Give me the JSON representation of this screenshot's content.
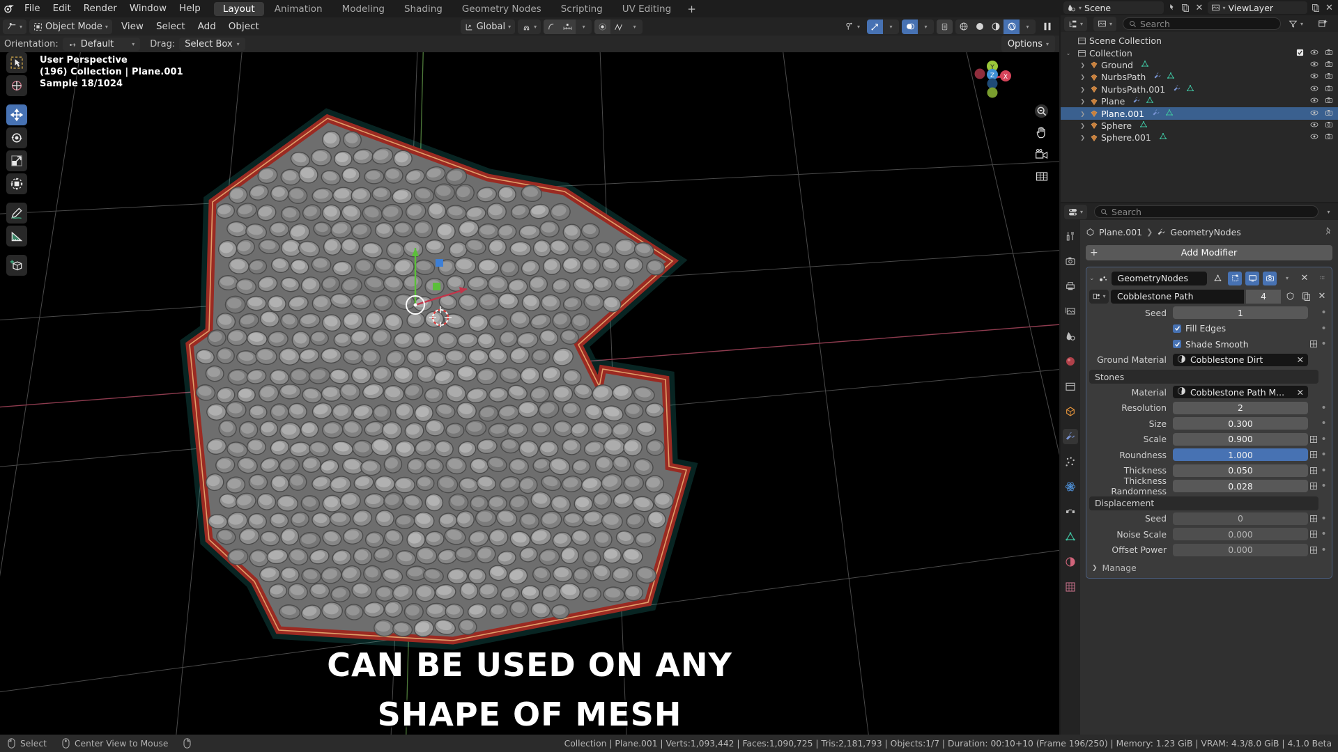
{
  "app": {
    "name": "Blender",
    "version_status": "4.1.0 Beta"
  },
  "topbar": {
    "menus": [
      "File",
      "Edit",
      "Render",
      "Window",
      "Help"
    ],
    "workspaces": [
      {
        "label": "Layout",
        "active": true
      },
      {
        "label": "Animation",
        "active": false
      },
      {
        "label": "Modeling",
        "active": false
      },
      {
        "label": "Shading",
        "active": false
      },
      {
        "label": "Geometry Nodes",
        "active": false
      },
      {
        "label": "Scripting",
        "active": false
      },
      {
        "label": "UV Editing",
        "active": false
      }
    ],
    "add_workspace": "+"
  },
  "viewport_header": {
    "mode": "Object Mode",
    "menus": [
      "View",
      "Select",
      "Add",
      "Object"
    ],
    "transform_orientation": "Global"
  },
  "tool_header": {
    "orientation_label": "Orientation:",
    "orientation_value": "Default",
    "drag_label": "Drag:",
    "drag_value": "Select Box",
    "options_label": "Options"
  },
  "viewport": {
    "overlay": {
      "perspective": "User Perspective",
      "collection_object": "(196) Collection | Plane.001",
      "samples": "Sample 18/1024"
    },
    "gizmo_axes": [
      "X",
      "Y",
      "Z"
    ],
    "subtitle_line1": "CAN BE USED ON ANY",
    "subtitle_line2": "SHAPE OF MESH",
    "tools": [
      {
        "name": "tweak-select-box",
        "active": false
      },
      {
        "name": "cursor",
        "active": false
      },
      {
        "name": "move",
        "active": true
      },
      {
        "name": "rotate",
        "active": false
      },
      {
        "name": "scale",
        "active": false
      },
      {
        "name": "transform",
        "active": false
      },
      {
        "name": "annotate",
        "active": false
      },
      {
        "name": "measure",
        "active": false
      },
      {
        "name": "add-cube",
        "active": false
      }
    ]
  },
  "outliner": {
    "scene_name": "Scene",
    "view_layer_name": "ViewLayer",
    "search_placeholder": "Search",
    "root": "Scene Collection",
    "collection": "Collection",
    "items": [
      {
        "name": "Ground",
        "selected": false,
        "has_modifier": false,
        "has_mesh": true
      },
      {
        "name": "NurbsPath",
        "selected": false,
        "has_modifier": true,
        "has_mesh": true
      },
      {
        "name": "NurbsPath.001",
        "selected": false,
        "has_modifier": true,
        "has_mesh": true
      },
      {
        "name": "Plane",
        "selected": false,
        "has_modifier": true,
        "has_mesh": true
      },
      {
        "name": "Plane.001",
        "selected": true,
        "has_modifier": true,
        "has_mesh": true
      },
      {
        "name": "Sphere",
        "selected": false,
        "has_modifier": false,
        "has_mesh": true
      },
      {
        "name": "Sphere.001",
        "selected": false,
        "has_modifier": false,
        "has_mesh": true
      }
    ]
  },
  "properties": {
    "search_placeholder": "Search",
    "breadcrumb_object": "Plane.001",
    "breadcrumb_modifier": "GeometryNodes",
    "add_modifier_label": "Add Modifier",
    "modifier": {
      "name": "GeometryNodes",
      "node_group": "Cobblestone Path",
      "users": "4",
      "params": [
        {
          "label": "Seed",
          "value": "1",
          "type": "number",
          "highlight": false,
          "animatable": false
        },
        {
          "label": "Fill Edges",
          "value": "",
          "type": "checkbox",
          "checked": true,
          "animatable": false
        },
        {
          "label": "Shade Smooth",
          "value": "",
          "type": "checkbox",
          "checked": true,
          "animatable": true
        },
        {
          "label": "Ground Material",
          "value": "Cobblestone Dirt",
          "type": "material"
        },
        {
          "label": "Stones",
          "value": "",
          "type": "section"
        },
        {
          "label": "Material",
          "value": "Cobblestone Path M...",
          "type": "material"
        },
        {
          "label": "Resolution",
          "value": "2",
          "type": "number",
          "highlight": false,
          "animatable": false
        },
        {
          "label": "Size",
          "value": "0.300",
          "type": "number",
          "highlight": false,
          "animatable": false
        },
        {
          "label": "Scale",
          "value": "0.900",
          "type": "number",
          "highlight": false,
          "animatable": true
        },
        {
          "label": "Roundness",
          "value": "1.000",
          "type": "number",
          "highlight": true,
          "animatable": true
        },
        {
          "label": "Thickness",
          "value": "0.050",
          "type": "number",
          "highlight": false,
          "animatable": true
        },
        {
          "label": "Thickness Randomness",
          "value": "0.028",
          "type": "number",
          "highlight": false,
          "animatable": true
        },
        {
          "label": "Displacement",
          "value": "",
          "type": "section"
        },
        {
          "label": "Seed",
          "value": "0",
          "type": "number",
          "highlight": false,
          "animatable": true,
          "dim": true
        },
        {
          "label": "Noise Scale",
          "value": "0.000",
          "type": "number",
          "highlight": false,
          "animatable": true,
          "dim": true
        },
        {
          "label": "Offset Power",
          "value": "0.000",
          "type": "number",
          "highlight": false,
          "animatable": true,
          "dim": true
        }
      ],
      "manage_label": "Manage"
    }
  },
  "statusbar": {
    "left": [
      {
        "icon": "mouse-left",
        "label": "Select"
      },
      {
        "icon": "mouse-middle",
        "label": "Center View to Mouse"
      },
      {
        "icon": "mouse-right",
        "label": ""
      }
    ],
    "scene_info": "Collection | Plane.001 | Verts:1,093,442 | Faces:1,090,725 | Tris:2,181,793 | Objects:1/7 | Duration: 00:10+10 (Frame 196/250) | Memory: 1.23 GiB | VRAM: 4.3/8.0 GiB | 4.1.0 Beta"
  },
  "colors": {
    "accent_blue": "#4772b3",
    "select_orange": "#ed9e5c",
    "mesh_green": "#2ecc9e",
    "modifier_blue": "#7a95d6",
    "selected_row": "#3a608f",
    "panel_bg": "#303030",
    "header_bg": "#232323"
  }
}
